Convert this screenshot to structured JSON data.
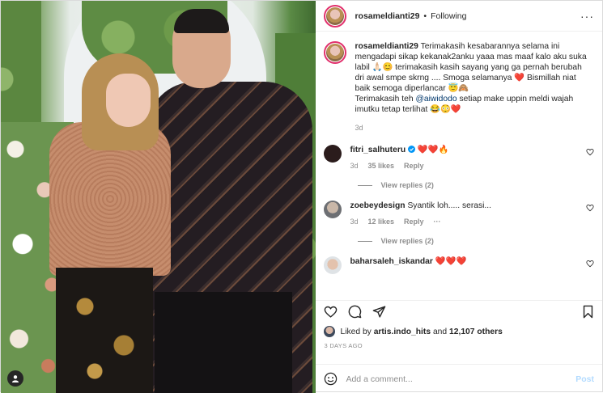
{
  "header": {
    "username": "rosameldianti29",
    "separator": "•",
    "following_label": "Following",
    "more_label": "···"
  },
  "caption": {
    "username": "rosameldianti29",
    "text_part1": "Terimakasih kesabarannya selama ini mengadapi sikap kekanak2anku yaaa mas maaf kalo aku suka labil 🙏🏻😊 terimakasih kasih sayang yang ga pernah berubah dri awal smpe skrng .... Smoga selamanya ❤️ Bismillah niat baik semoga diperlancar 😇🙈",
    "text_part2": "Terimakasih teh",
    "mention": "@aiwidodo",
    "text_part3": "setiap make uppin meldi wajah imutku tetap terlihat 😂😳❤️",
    "time": "3d"
  },
  "comments": [
    {
      "username": "fitri_salhuteru",
      "text": "❤️❤️🔥",
      "verified": true,
      "time": "3d",
      "likes": "35 likes",
      "reply_label": "Reply",
      "view_replies": "View replies (2)"
    },
    {
      "username": "zoebeydesign",
      "text": "Syantik loh..... serasi...",
      "verified": false,
      "time": "3d",
      "likes": "12 likes",
      "reply_label": "Reply",
      "more_label": "···",
      "view_replies": "View replies (2)"
    },
    {
      "username": "baharsaleh_iskandar",
      "text": "❤️❤️❤️",
      "verified": false
    }
  ],
  "likes": {
    "prefix": "Liked by",
    "user": "artis.indo_hits",
    "and": "and",
    "count": "12,107 others"
  },
  "timestamp": "3 DAYS AGO",
  "add_comment": {
    "placeholder": "Add a comment...",
    "post_label": "Post"
  },
  "colors": {
    "verified": "#0095f6",
    "heart_red": "#ed4956",
    "post_disabled": "#b3dbff",
    "secondary_text": "#8e8e8e"
  }
}
